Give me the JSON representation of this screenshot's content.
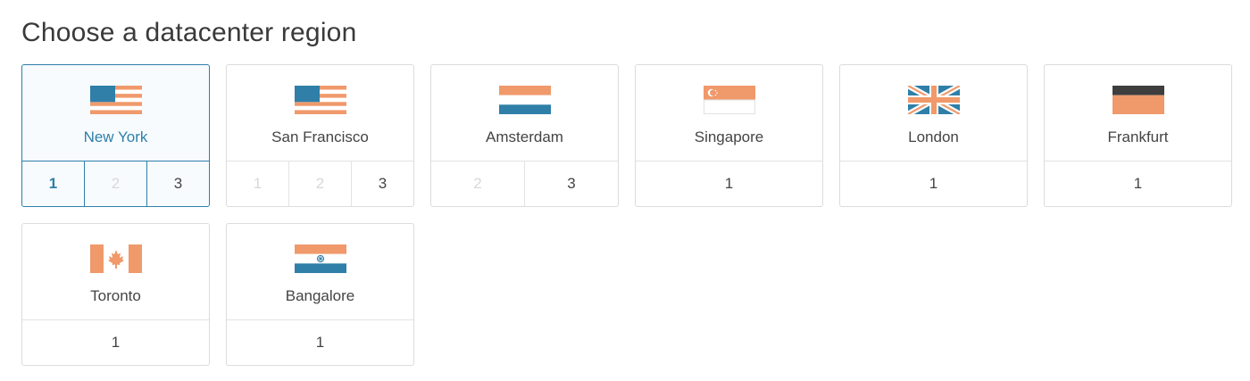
{
  "page": {
    "title": "Choose a datacenter region"
  },
  "colors": {
    "accent": "#2f7fa8",
    "flag_orange": "#f0996b",
    "flag_blue": "#2f7fa8",
    "flag_dark": "#3e3e3e"
  },
  "regions": [
    {
      "name": "New York",
      "flag": "us-flag-icon",
      "selected": true,
      "datacenters": [
        {
          "label": "1",
          "state": "active"
        },
        {
          "label": "2",
          "state": "disabled"
        },
        {
          "label": "3",
          "state": "enabled"
        }
      ]
    },
    {
      "name": "San Francisco",
      "flag": "us-flag-icon",
      "selected": false,
      "datacenters": [
        {
          "label": "1",
          "state": "disabled"
        },
        {
          "label": "2",
          "state": "disabled"
        },
        {
          "label": "3",
          "state": "enabled"
        }
      ]
    },
    {
      "name": "Amsterdam",
      "flag": "netherlands-flag-icon",
      "selected": false,
      "datacenters": [
        {
          "label": "2",
          "state": "disabled"
        },
        {
          "label": "3",
          "state": "enabled"
        }
      ]
    },
    {
      "name": "Singapore",
      "flag": "singapore-flag-icon",
      "selected": false,
      "datacenters": [
        {
          "label": "1",
          "state": "enabled"
        }
      ]
    },
    {
      "name": "London",
      "flag": "uk-flag-icon",
      "selected": false,
      "datacenters": [
        {
          "label": "1",
          "state": "enabled"
        }
      ]
    },
    {
      "name": "Frankfurt",
      "flag": "germany-flag-icon",
      "selected": false,
      "datacenters": [
        {
          "label": "1",
          "state": "enabled"
        }
      ]
    },
    {
      "name": "Toronto",
      "flag": "canada-flag-icon",
      "selected": false,
      "datacenters": [
        {
          "label": "1",
          "state": "enabled"
        }
      ]
    },
    {
      "name": "Bangalore",
      "flag": "india-flag-icon",
      "selected": false,
      "datacenters": [
        {
          "label": "1",
          "state": "enabled"
        }
      ]
    }
  ]
}
